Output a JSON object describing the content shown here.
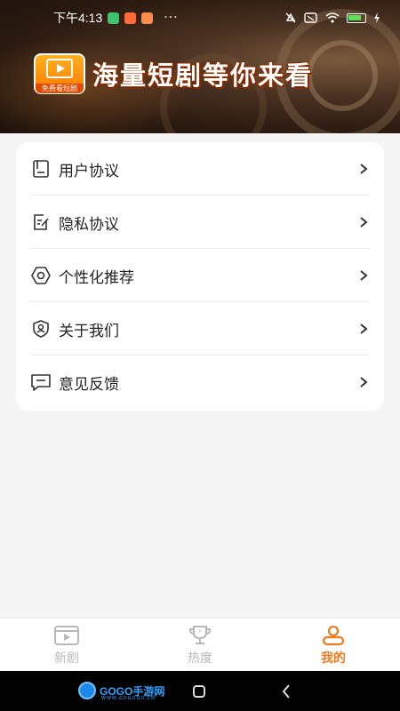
{
  "status_bar": {
    "time": "下午4:13",
    "dots": "···",
    "battery_color": "#5ce05c"
  },
  "banner": {
    "logo_caption": "免费看短剧",
    "slogan": "海量短剧等你来看"
  },
  "menu": [
    {
      "label": "用户协议",
      "icon": "document-icon"
    },
    {
      "label": "隐私协议",
      "icon": "edit-document-icon"
    },
    {
      "label": "个性化推荐",
      "icon": "gear-icon"
    },
    {
      "label": "关于我们",
      "icon": "shield-user-icon"
    },
    {
      "label": "意见反馈",
      "icon": "message-icon"
    }
  ],
  "bottom_nav": [
    {
      "label": "新剧",
      "icon": "video-icon",
      "active": false
    },
    {
      "label": "热度",
      "icon": "trophy-icon",
      "active": false
    },
    {
      "label": "我的",
      "icon": "user-icon",
      "active": true
    }
  ],
  "watermark": {
    "text": "GOGO手游网",
    "sub": "WWW.GOGOGO.CN"
  },
  "colors": {
    "accent": "#f07a1e",
    "inactive": "#b8b8b8"
  }
}
